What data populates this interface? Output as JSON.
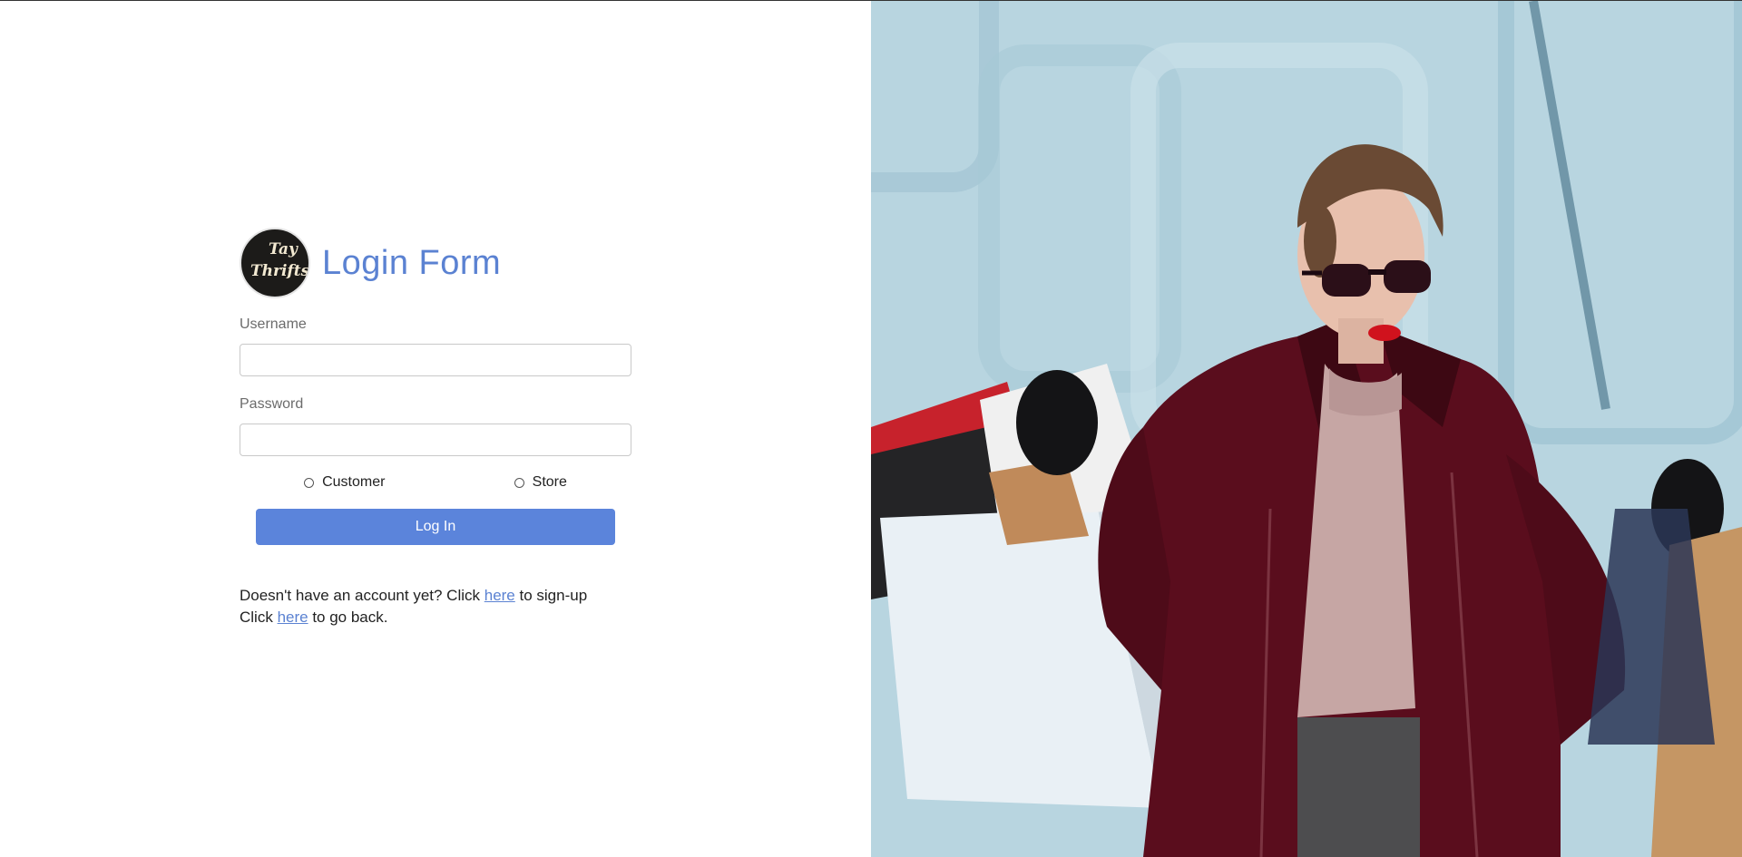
{
  "brand": {
    "logo_line1": "Tay",
    "logo_line2": "Thrifts"
  },
  "login": {
    "title": "Login Form",
    "username_label": "Username",
    "username_value": "",
    "password_label": "Password",
    "password_value": "",
    "roles": [
      {
        "label": "Customer",
        "selected": false
      },
      {
        "label": "Store",
        "selected": false
      }
    ],
    "submit_label": "Log In"
  },
  "helper": {
    "signup_prefix": "Doesn't have an account yet? Click ",
    "signup_link": "here",
    "signup_suffix": " to sign-up",
    "back_prefix": "Click ",
    "back_link": "here",
    "back_suffix": " to go back."
  },
  "colors": {
    "accent": "#5b82d2",
    "button": "#5b84db",
    "coat": "#5c0e1e",
    "backdrop": "#b9d6e1"
  },
  "hero_image": {
    "icon": "shopping-woman-photo"
  }
}
